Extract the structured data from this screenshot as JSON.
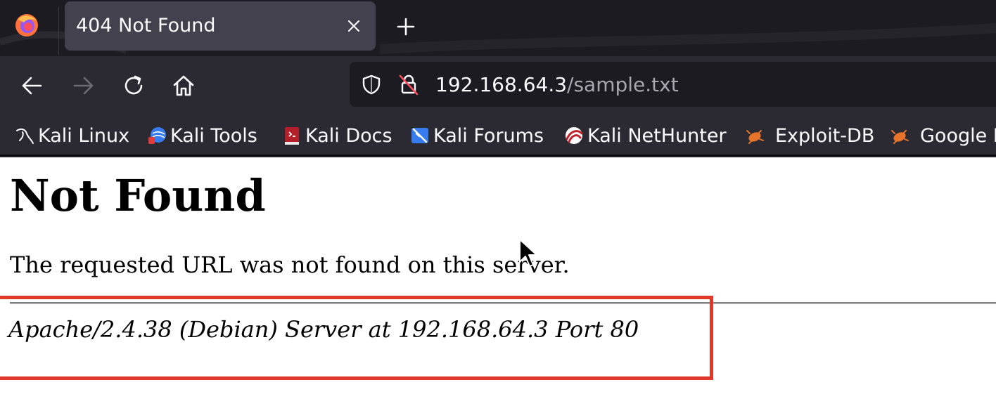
{
  "browser": {
    "tab": {
      "title": "404 Not Found",
      "close_icon": "close-icon"
    },
    "new_tab_icon": "plus-icon",
    "nav": {
      "back_icon": "arrow-left-icon",
      "forward_icon": "arrow-right-icon",
      "reload_icon": "reload-icon",
      "home_icon": "home-icon"
    },
    "url": {
      "host": "192.168.64.3",
      "path": "/sample.txt",
      "tracking_icon": "shield-icon",
      "insecure_icon": "insecure-lock-icon"
    },
    "bookmarks": [
      {
        "label": "Kali Linux",
        "icon": "kali-dragon-icon"
      },
      {
        "label": "Kali Tools",
        "icon": "kali-tools-icon"
      },
      {
        "label": "Kali Docs",
        "icon": "kali-docs-icon"
      },
      {
        "label": "Kali Forums",
        "icon": "kali-forums-icon"
      },
      {
        "label": "Kali NetHunter",
        "icon": "kali-nethunter-icon"
      },
      {
        "label": "Exploit-DB",
        "icon": "exploit-db-icon"
      },
      {
        "label": "Google H",
        "icon": "google-hacking-db-icon"
      }
    ]
  },
  "page": {
    "heading": "Not Found",
    "message": "The requested URL was not found on this server.",
    "server_signature": "Apache/2.4.38 (Debian) Server at 192.168.64.3 Port 80"
  },
  "colors": {
    "chrome_dark": "#1c1b22",
    "toolbar": "#2b2a33",
    "tab_active": "#42414d",
    "highlight_box": "#e0392b"
  }
}
